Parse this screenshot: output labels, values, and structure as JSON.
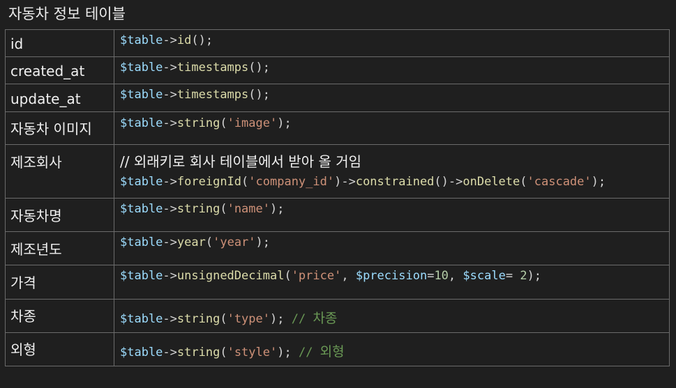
{
  "title": "자동차 정보 테이블",
  "colors": {
    "background": "#1f1f1f",
    "border": "#6b6b6b",
    "variable": "#9cdcfe",
    "function": "#dcdcaa",
    "string": "#ce9178",
    "number": "#b5cea8",
    "comment": "#6a9955"
  },
  "rows": [
    {
      "field": "id",
      "comment": "",
      "tokens": [
        {
          "t": "var",
          "v": "$table"
        },
        {
          "t": "op",
          "v": "->"
        },
        {
          "t": "fn",
          "v": "id"
        },
        {
          "t": "op",
          "v": "();"
        }
      ]
    },
    {
      "field": "created_at",
      "comment": "",
      "tokens": [
        {
          "t": "var",
          "v": "$table"
        },
        {
          "t": "op",
          "v": "->"
        },
        {
          "t": "fn",
          "v": "timestamps"
        },
        {
          "t": "op",
          "v": "();"
        }
      ]
    },
    {
      "field": "update_at",
      "comment": "",
      "tokens": [
        {
          "t": "var",
          "v": "$table"
        },
        {
          "t": "op",
          "v": "->"
        },
        {
          "t": "fn",
          "v": "timestamps"
        },
        {
          "t": "op",
          "v": "();"
        }
      ]
    },
    {
      "field": "자동차 이미지",
      "comment": "",
      "tokens": [
        {
          "t": "var",
          "v": "$table"
        },
        {
          "t": "op",
          "v": "->"
        },
        {
          "t": "fn",
          "v": "string"
        },
        {
          "t": "op",
          "v": "("
        },
        {
          "t": "str",
          "v": "'image'"
        },
        {
          "t": "op",
          "v": ");"
        }
      ]
    },
    {
      "field": "제조회사",
      "comment": "// 외래키로 회사 테이블에서 받아 올 거임",
      "tokens": [
        {
          "t": "var",
          "v": "$table"
        },
        {
          "t": "op",
          "v": "->"
        },
        {
          "t": "fn",
          "v": "foreignId"
        },
        {
          "t": "op",
          "v": "("
        },
        {
          "t": "str",
          "v": "'company_id'"
        },
        {
          "t": "op",
          "v": ")->"
        },
        {
          "t": "fn",
          "v": "constrained"
        },
        {
          "t": "op",
          "v": "()->"
        },
        {
          "t": "fn",
          "v": "onDelete"
        },
        {
          "t": "op",
          "v": "("
        },
        {
          "t": "str",
          "v": "'cascade'"
        },
        {
          "t": "op",
          "v": ");"
        }
      ]
    },
    {
      "field": "자동차명",
      "comment": "",
      "tokens": [
        {
          "t": "var",
          "v": "$table"
        },
        {
          "t": "op",
          "v": "->"
        },
        {
          "t": "fn",
          "v": "string"
        },
        {
          "t": "op",
          "v": "("
        },
        {
          "t": "str",
          "v": "'name'"
        },
        {
          "t": "op",
          "v": ");"
        }
      ]
    },
    {
      "field": "제조년도",
      "comment": "",
      "tokens": [
        {
          "t": "var",
          "v": "$table"
        },
        {
          "t": "op",
          "v": "->"
        },
        {
          "t": "fn",
          "v": "year"
        },
        {
          "t": "op",
          "v": "("
        },
        {
          "t": "str",
          "v": "'year'"
        },
        {
          "t": "op",
          "v": ");"
        }
      ]
    },
    {
      "field": "가격",
      "comment": "",
      "tokens": [
        {
          "t": "var",
          "v": "$table"
        },
        {
          "t": "op",
          "v": "->"
        },
        {
          "t": "fn",
          "v": "unsignedDecimal"
        },
        {
          "t": "op",
          "v": "("
        },
        {
          "t": "str",
          "v": "'price'"
        },
        {
          "t": "op",
          "v": ", "
        },
        {
          "t": "var",
          "v": "$precision"
        },
        {
          "t": "op",
          "v": "="
        },
        {
          "t": "num",
          "v": "10"
        },
        {
          "t": "op",
          "v": ", "
        },
        {
          "t": "var",
          "v": "$scale"
        },
        {
          "t": "op",
          "v": "= "
        },
        {
          "t": "num",
          "v": "2"
        },
        {
          "t": "op",
          "v": ");"
        }
      ]
    },
    {
      "field": "차종",
      "comment": "",
      "tokens": [
        {
          "t": "var",
          "v": "$table"
        },
        {
          "t": "op",
          "v": "->"
        },
        {
          "t": "fn",
          "v": "string"
        },
        {
          "t": "op",
          "v": "("
        },
        {
          "t": "str",
          "v": "'type'"
        },
        {
          "t": "op",
          "v": "); "
        },
        {
          "t": "cmt",
          "v": "// "
        },
        {
          "t": "cmtkr",
          "v": "차종"
        }
      ]
    },
    {
      "field": "외형",
      "comment": "",
      "tokens": [
        {
          "t": "var",
          "v": "$table"
        },
        {
          "t": "op",
          "v": "->"
        },
        {
          "t": "fn",
          "v": "string"
        },
        {
          "t": "op",
          "v": "("
        },
        {
          "t": "str",
          "v": "'style'"
        },
        {
          "t": "op",
          "v": "); "
        },
        {
          "t": "cmt",
          "v": "// "
        },
        {
          "t": "cmtkr",
          "v": "외형"
        }
      ]
    }
  ]
}
